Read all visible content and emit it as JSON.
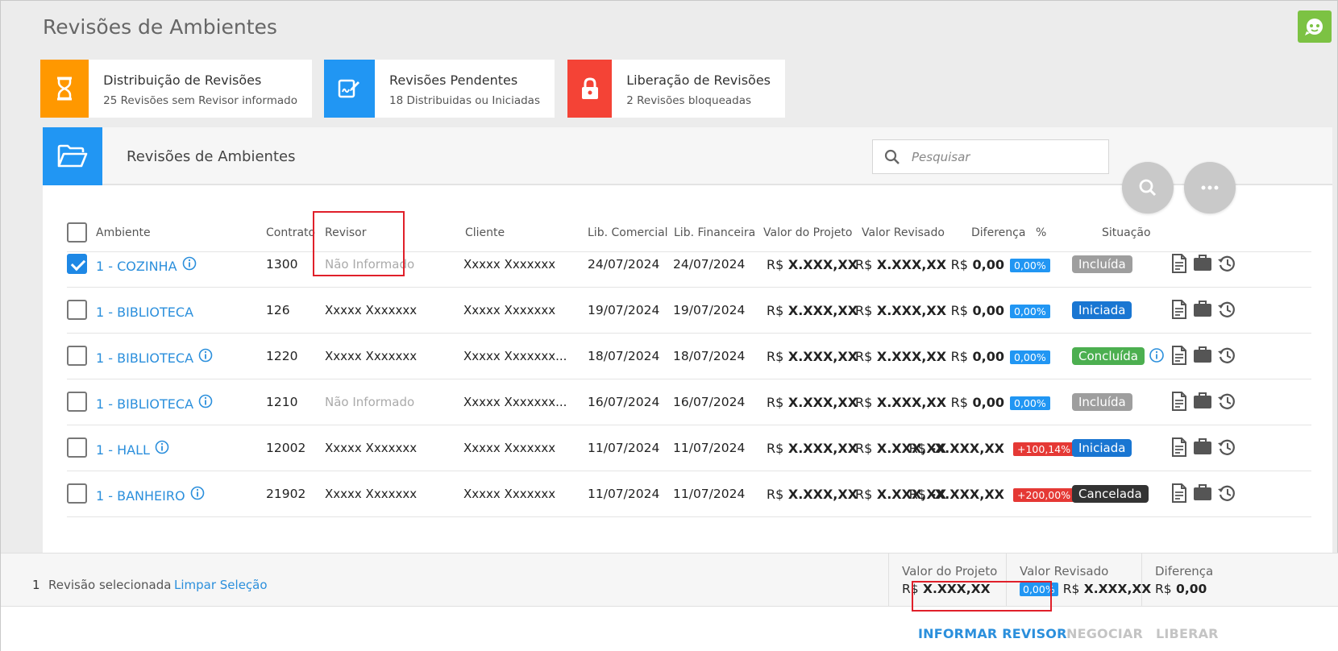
{
  "page": {
    "title": "Revisões de Ambientes"
  },
  "cards": [
    {
      "title": "Distribuição de Revisões",
      "subtitle": "25 Revisões sem Revisor informado",
      "color": "#ff9800",
      "icon": "hourglass-icon"
    },
    {
      "title": "Revisões Pendentes",
      "subtitle": "18 Distribuidas ou Iniciadas",
      "color": "#2196f3",
      "icon": "signature-icon"
    },
    {
      "title": "Liberação de Revisões",
      "subtitle": "2 Revisões bloqueadas",
      "color": "#f44336",
      "icon": "lock-icon"
    }
  ],
  "panel": {
    "title": "Revisões de Ambientes",
    "search_placeholder": "Pesquisar"
  },
  "table": {
    "headers": {
      "ambiente": "Ambiente",
      "contrato": "Contrato",
      "revisor": "Revisor",
      "cliente": "Cliente",
      "lib_comercial": "Lib. Comercial",
      "lib_financeira": "Lib. Financeira",
      "valor_projeto": "Valor do Projeto",
      "valor_revisado": "Valor Revisado",
      "diferenca": "Diferença",
      "pct": "%",
      "situacao": "Situação"
    },
    "rows": [
      {
        "checked": true,
        "ambiente": "1 - COZINHA",
        "info": true,
        "contrato": "1300",
        "revisor": "Não Informado",
        "revisor_missing": true,
        "cliente": "Xxxxx Xxxxxxx",
        "lib_comercial": "24/07/2024",
        "lib_financeira": "24/07/2024",
        "valor_projeto": "X.XXX,XX",
        "valor_revisado": "X.XXX,XX",
        "diferenca": "0,00",
        "pct": "0,00%",
        "pct_color": "#2196f3",
        "situacao": "Incluída",
        "sit_color": "#9e9e9e",
        "extra_info": false
      },
      {
        "checked": false,
        "ambiente": "1 - BIBLIOTECA",
        "info": false,
        "contrato": "126",
        "revisor": "Xxxxx Xxxxxxx",
        "revisor_missing": false,
        "cliente": "Xxxxx Xxxxxxx",
        "lib_comercial": "19/07/2024",
        "lib_financeira": "19/07/2024",
        "valor_projeto": "X.XXX,XX",
        "valor_revisado": "X.XXX,XX",
        "diferenca": "0,00",
        "pct": "0,00%",
        "pct_color": "#2196f3",
        "situacao": "Iniciada",
        "sit_color": "#1976d2",
        "extra_info": false
      },
      {
        "checked": false,
        "ambiente": "1 - BIBLIOTECA",
        "info": true,
        "contrato": "1220",
        "revisor": "Xxxxx Xxxxxxx",
        "revisor_missing": false,
        "cliente": "Xxxxx Xxxxxxx...",
        "lib_comercial": "18/07/2024",
        "lib_financeira": "18/07/2024",
        "valor_projeto": "X.XXX,XX",
        "valor_revisado": "X.XXX,XX",
        "diferenca": "0,00",
        "pct": "0,00%",
        "pct_color": "#2196f3",
        "situacao": "Concluída",
        "sit_color": "#4caf50",
        "extra_info": true
      },
      {
        "checked": false,
        "ambiente": "1 - BIBLIOTECA",
        "info": true,
        "contrato": "1210",
        "revisor": "Não Informado",
        "revisor_missing": true,
        "cliente": "Xxxxx Xxxxxxx...",
        "lib_comercial": "16/07/2024",
        "lib_financeira": "16/07/2024",
        "valor_projeto": "X.XXX,XX",
        "valor_revisado": "X.XXX,XX",
        "diferenca": "0,00",
        "pct": "0,00%",
        "pct_color": "#2196f3",
        "situacao": "Incluída",
        "sit_color": "#9e9e9e",
        "extra_info": false
      },
      {
        "checked": false,
        "ambiente": "1 - HALL",
        "info": true,
        "contrato": "12002",
        "revisor": "Xxxxx Xxxxxxx",
        "revisor_missing": false,
        "cliente": "Xxxxx Xxxxxxx",
        "lib_comercial": "11/07/2024",
        "lib_financeira": "11/07/2024",
        "valor_projeto": "X.XXX,XX",
        "valor_revisado": "X.XXX,XX",
        "diferenca": "-X.XXX,XX",
        "pct": "+100,14%",
        "pct_color": "#e53935",
        "situacao": "Iniciada",
        "sit_color": "#1976d2",
        "extra_info": false
      },
      {
        "checked": false,
        "ambiente": "1 - BANHEIRO",
        "info": true,
        "contrato": "21902",
        "revisor": "Xxxxx Xxxxxxx",
        "revisor_missing": false,
        "cliente": "Xxxxx Xxxxxxx",
        "lib_comercial": "11/07/2024",
        "lib_financeira": "11/07/2024",
        "valor_projeto": "X.XXX,XX",
        "valor_revisado": "X.XXX,XX",
        "diferenca": "-X.XXX,XX",
        "pct": "+200,00%",
        "pct_color": "#e53935",
        "situacao": "Cancelada",
        "sit_color": "#333333",
        "extra_info": false
      }
    ]
  },
  "currency": "R$",
  "footer": {
    "selected_count": "1",
    "selected_label": "Revisão selecionada",
    "clear_label": "Limpar Seleção",
    "totals": {
      "valor_projeto_label": "Valor do Projeto",
      "valor_projeto": "X.XXX,XX",
      "valor_revisado_label": "Valor Revisado",
      "valor_revisado_pct": "0,00%",
      "valor_revisado": "X.XXX,XX",
      "diferenca_label": "Diferença",
      "diferenca": "0,00"
    },
    "actions": {
      "informar": "INFORMAR REVISOR",
      "negociar": "NEGOCIAR",
      "liberar": "LIBERAR"
    }
  },
  "colors": {
    "accent": "#2196f3",
    "link": "#2b8fdc",
    "highlight": "#e0202a",
    "chat": "#7cc243"
  }
}
